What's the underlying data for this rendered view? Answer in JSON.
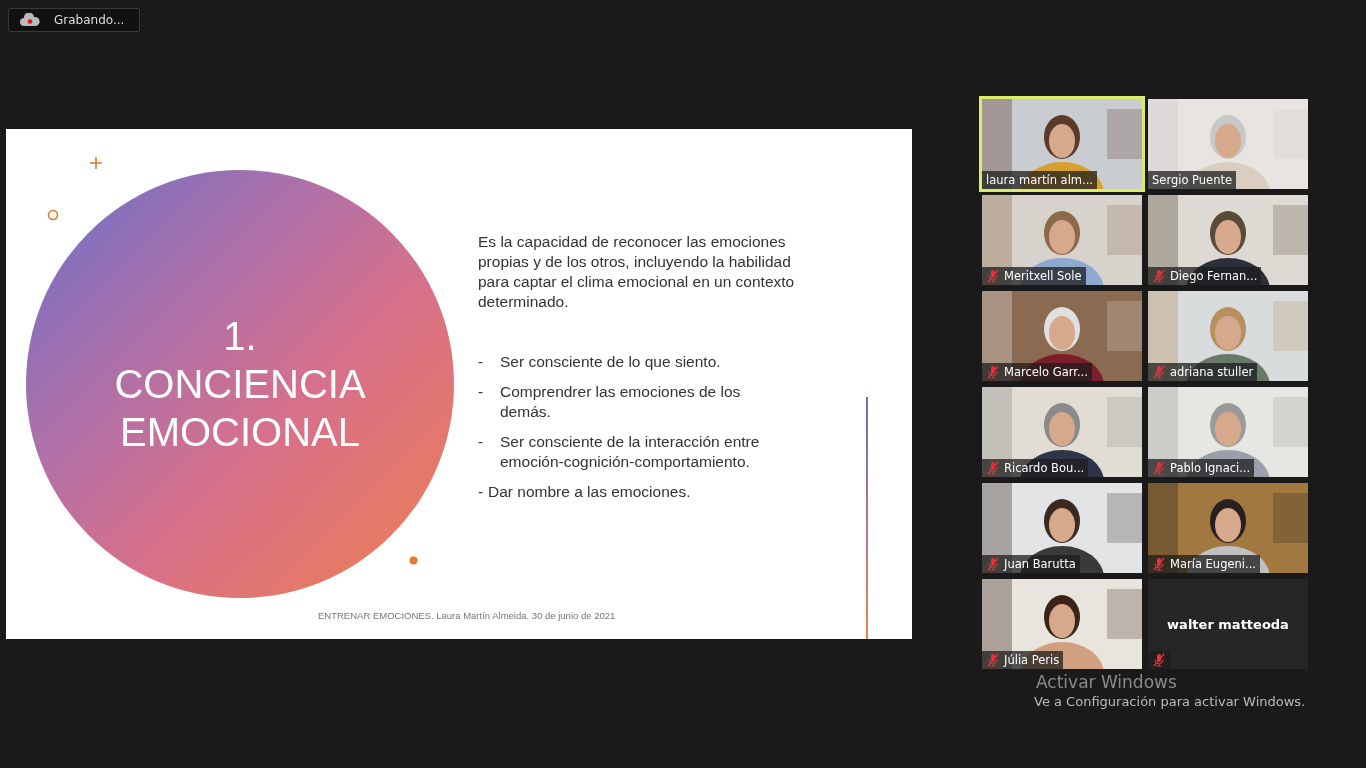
{
  "recording": {
    "label": "Grabando..."
  },
  "slide": {
    "title_lines": [
      "1.",
      "CONCIENCIA",
      "EMOCIONAL"
    ],
    "paragraph": "Es la capacidad de reconocer las emociones propias y de los otros, incluyendo la habilidad para captar el clima emocional en un contexto determinado.",
    "bullets": [
      {
        "marker": "-",
        "text": "Ser consciente de lo que siento.",
        "indented": true
      },
      {
        "marker": "-",
        "text": "Comprendrer las emociones de los demás.",
        "indented": true
      },
      {
        "marker": "-",
        "text": "Ser consciente de la interacción entre emoción-cognición-comportamiento.",
        "indented": true
      },
      {
        "marker": "-",
        "text": "Dar nombre a las emociones.",
        "indented": false
      }
    ],
    "footer": "ENTRENAR EMOCIONES. Laura Martín Almeida. 30 de junio de 2021"
  },
  "participants": [
    {
      "name": "laura martín alm...",
      "muted": false,
      "speaking": true,
      "video": true
    },
    {
      "name": "Sergio Puente",
      "muted": false,
      "speaking": false,
      "video": true
    },
    {
      "name": "Meritxell Sole",
      "muted": true,
      "speaking": false,
      "video": true
    },
    {
      "name": "Diego Fernan...",
      "muted": true,
      "speaking": false,
      "video": true
    },
    {
      "name": "Marcelo Garr...",
      "muted": true,
      "speaking": false,
      "video": true
    },
    {
      "name": "adriana stuller",
      "muted": true,
      "speaking": false,
      "video": true
    },
    {
      "name": "Ricardo Bou...",
      "muted": true,
      "speaking": false,
      "video": true
    },
    {
      "name": "Pablo Ignaci...",
      "muted": true,
      "speaking": false,
      "video": true
    },
    {
      "name": "Juan Barutta",
      "muted": true,
      "speaking": false,
      "video": true
    },
    {
      "name": "María Eugeni...",
      "muted": true,
      "speaking": false,
      "video": true
    },
    {
      "name": "Júlia Peris",
      "muted": true,
      "speaking": false,
      "video": true
    },
    {
      "name": "walter matteoda",
      "muted": true,
      "speaking": false,
      "video": false
    }
  ],
  "activation_notice": {
    "title": "Activar Windows",
    "message": "Ve a Configuración para activar Windows."
  }
}
